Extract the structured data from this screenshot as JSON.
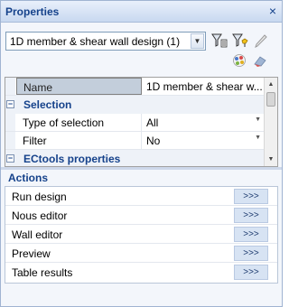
{
  "panel": {
    "title": "Properties",
    "close_glyph": "×"
  },
  "toolbar": {
    "selection": "1D member & shear wall design (1)",
    "icons": [
      "filter-select-icon",
      "filter-add-icon",
      "pencil-icon",
      "color-palette-icon",
      "clear-selection-icon"
    ]
  },
  "grid": {
    "name_row": {
      "key": "Name",
      "value": "1D member & shear w..."
    },
    "selection_category": {
      "sign": "−",
      "label": "Selection"
    },
    "rows": [
      {
        "key": "Type of selection",
        "value": "All"
      },
      {
        "key": "Filter",
        "value": "No"
      }
    ],
    "ectools_category": {
      "sign": "−",
      "label": "ECtools properties"
    }
  },
  "actions": {
    "header": "Actions",
    "items": [
      {
        "label": "Run design",
        "button": ">>>"
      },
      {
        "label": "Nous editor",
        "button": ">>>"
      },
      {
        "label": "Wall editor",
        "button": ">>>"
      },
      {
        "label": "Preview",
        "button": ">>>"
      },
      {
        "label": "Table results",
        "button": ">>>"
      }
    ]
  },
  "colors": {
    "title_text": "#15428b",
    "panel_bg": "#f3f6fb",
    "button_bg": "#d7e3f3"
  }
}
